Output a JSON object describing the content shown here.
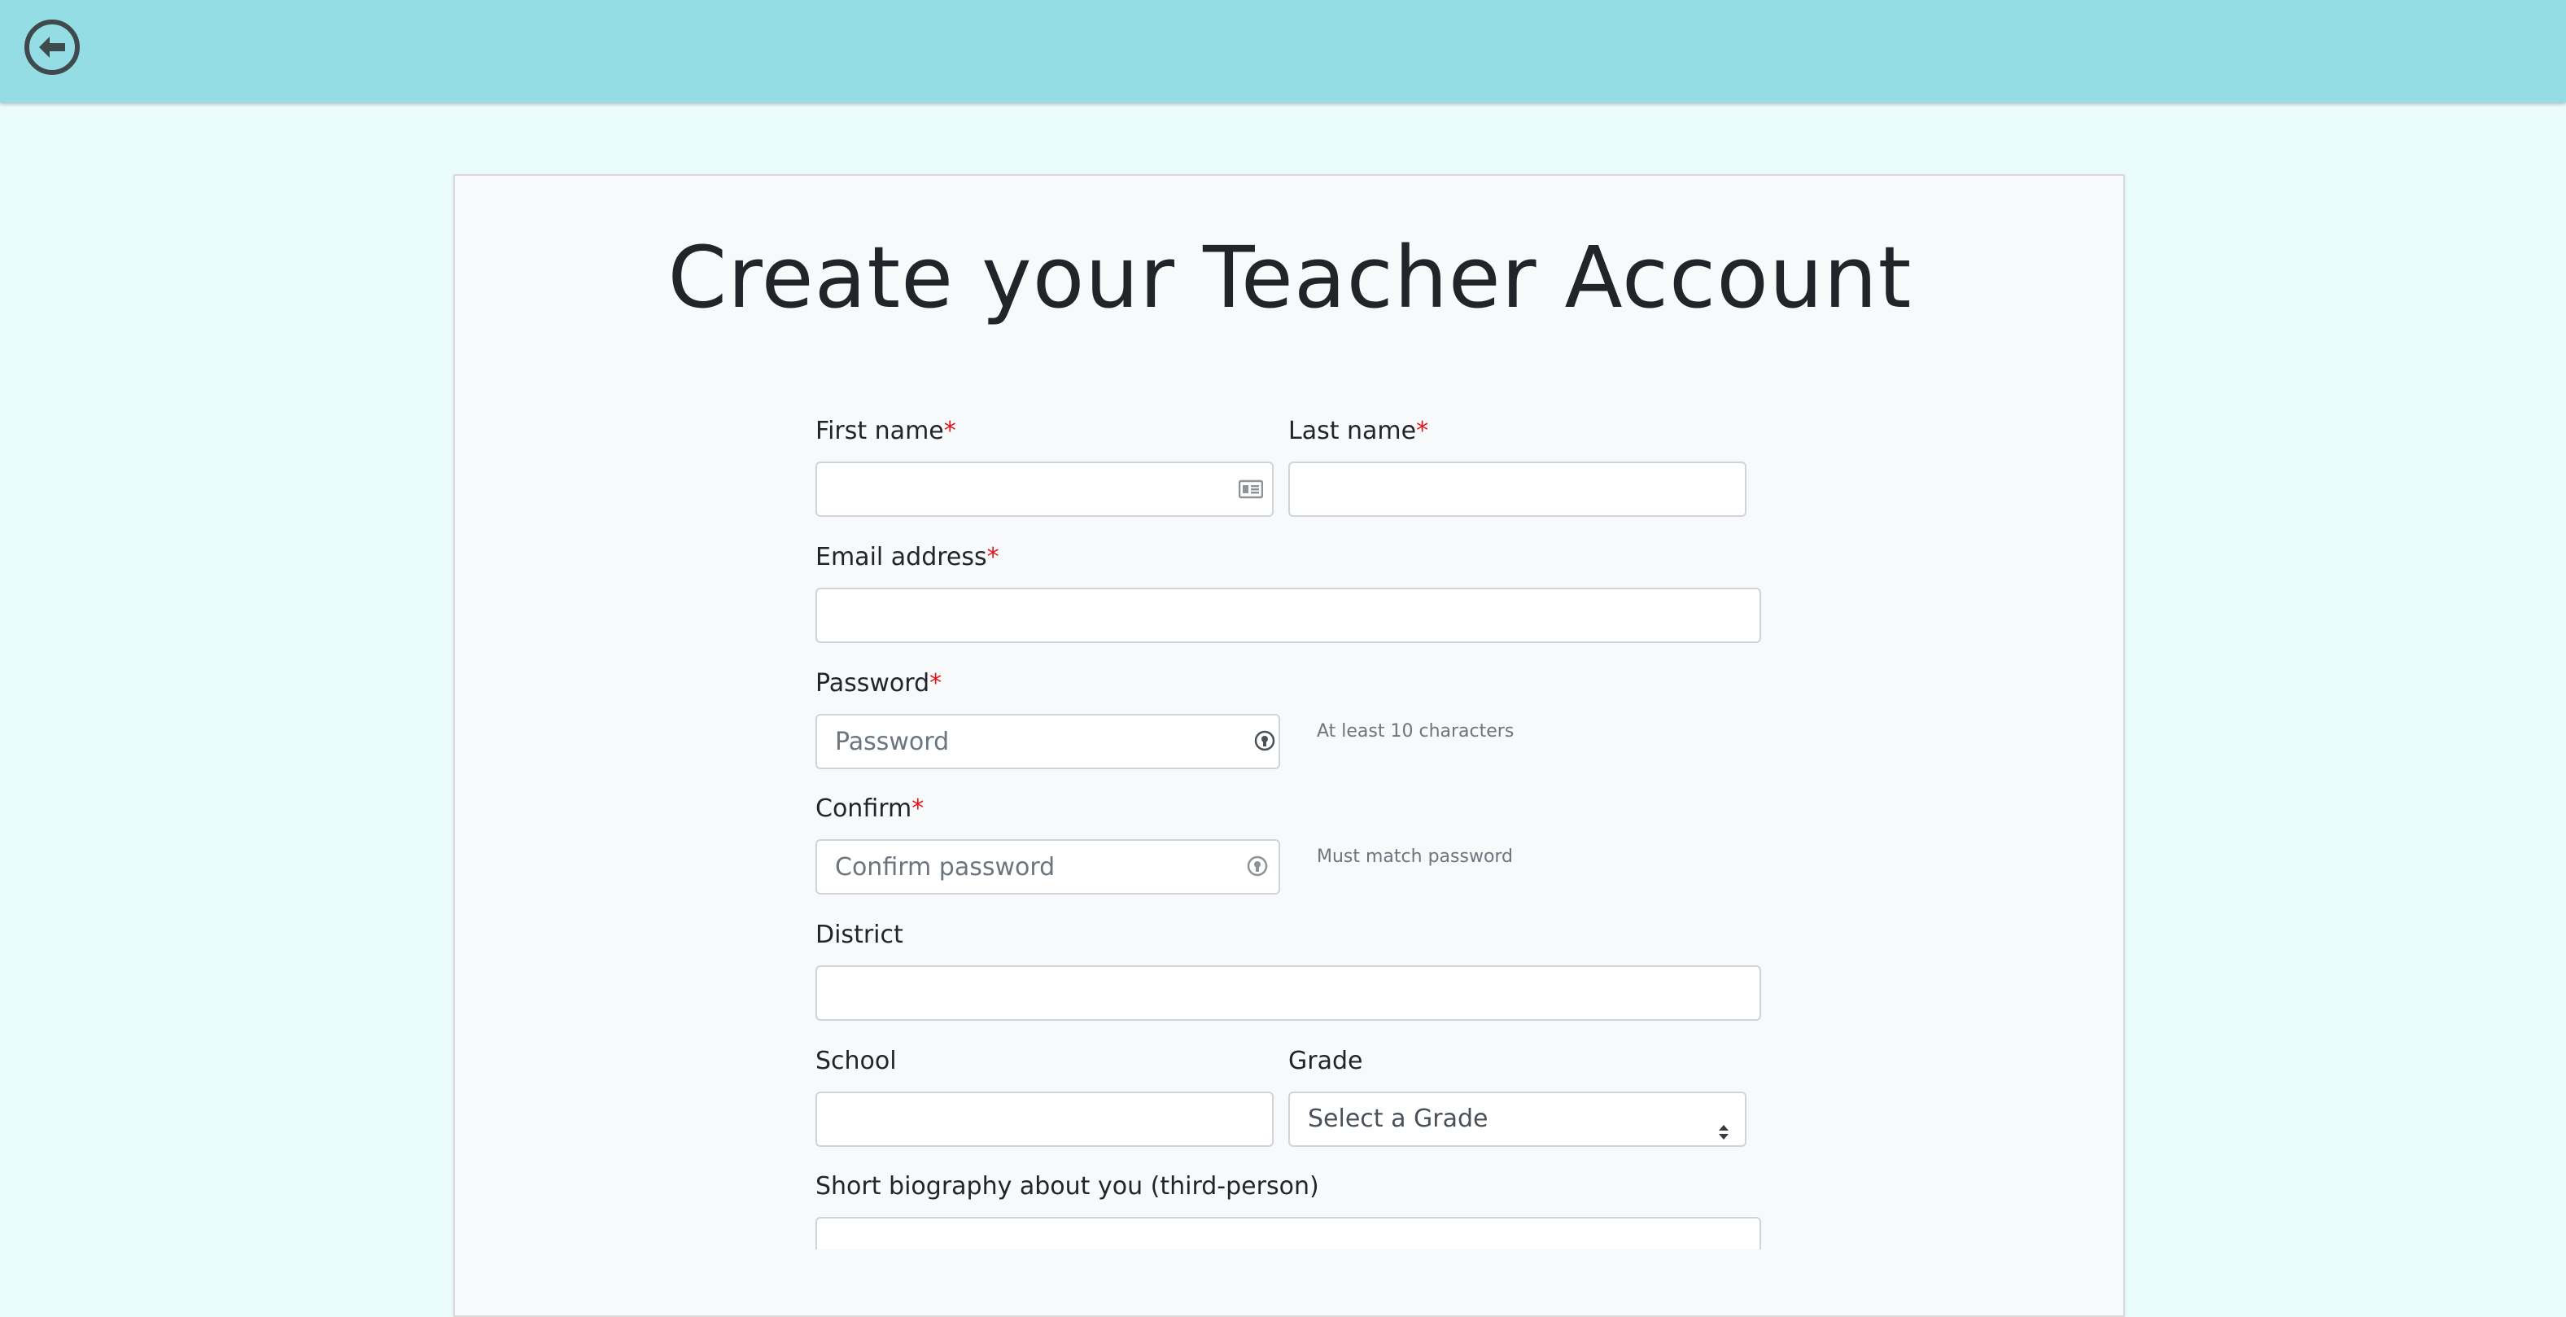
{
  "header": {
    "back_icon": "arrow-left-circle-icon",
    "colors": {
      "bar": "#95dde5",
      "page": "#ebfcfc"
    }
  },
  "form": {
    "title": "Create your Teacher Account",
    "required_marker": "*",
    "first_name": {
      "label": "First name",
      "value": "",
      "icon": "id-card-icon"
    },
    "last_name": {
      "label": "Last name",
      "value": ""
    },
    "email": {
      "label": "Email address",
      "value": ""
    },
    "password": {
      "label": "Password",
      "placeholder": "Password",
      "help": "At least 10 characters",
      "icon": "password-manager-icon"
    },
    "confirm": {
      "label": "Confirm",
      "placeholder": "Confirm password",
      "help": "Must match password",
      "icon": "password-manager-icon"
    },
    "district": {
      "label": "District",
      "value": ""
    },
    "school": {
      "label": "School",
      "value": ""
    },
    "grade": {
      "label": "Grade",
      "selected": "Select a Grade"
    },
    "bio": {
      "label": "Short biography about you (third-person)"
    }
  }
}
